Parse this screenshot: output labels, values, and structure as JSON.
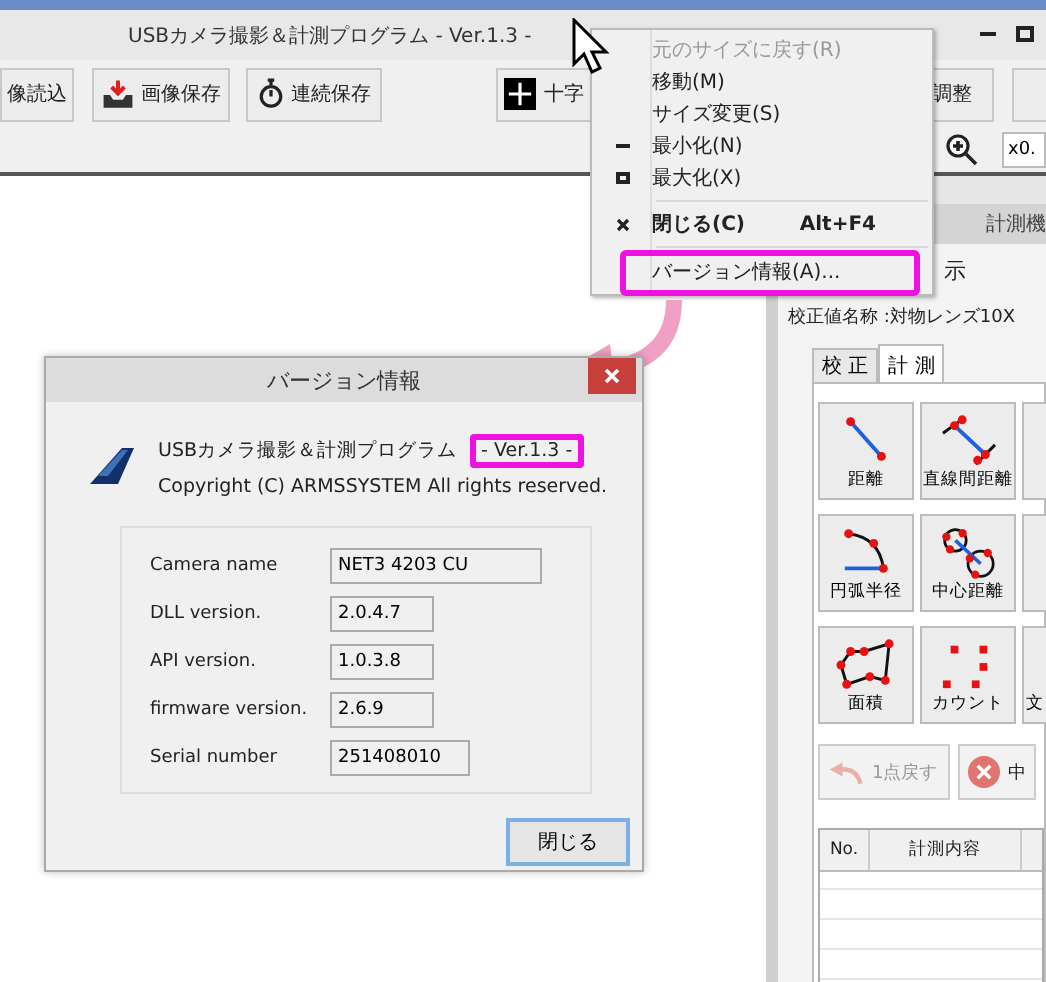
{
  "title_bar": {
    "title": "USBカメラ撮影＆計測プログラム  - Ver.1.3 -"
  },
  "toolbar": [
    {
      "label": "像読込",
      "kind": "plain"
    },
    {
      "label": "画像保存",
      "kind": "save"
    },
    {
      "label": "連続保存",
      "kind": "timer"
    },
    {
      "label": "十字",
      "kind": "cross"
    },
    {
      "label": "調整",
      "kind": "plain"
    }
  ],
  "zoom_field": {
    "value": "x0."
  },
  "system_menu": {
    "items": [
      {
        "label": "元のサイズに戻す(R)",
        "disabled": true,
        "kind": "plain",
        "separator_before": false,
        "highlighted": false
      },
      {
        "label": "移動(M)",
        "disabled": false,
        "kind": "plain",
        "separator_before": false,
        "highlighted": false
      },
      {
        "label": "サイズ変更(S)",
        "disabled": false,
        "kind": "plain",
        "separator_before": false,
        "highlighted": false
      },
      {
        "label": "最小化(N)",
        "disabled": false,
        "kind": "minimize",
        "separator_before": false,
        "highlighted": false
      },
      {
        "label": "最大化(X)",
        "disabled": false,
        "kind": "maximize",
        "separator_before": false,
        "highlighted": false
      },
      {
        "label": "閉じる(C)",
        "shortcut": "Alt+F4",
        "disabled": false,
        "kind": "close",
        "separator_before": true,
        "highlighted": false
      },
      {
        "label": "バージョン情報(A)...",
        "disabled": false,
        "kind": "plain",
        "separator_before": true,
        "highlighted": true
      }
    ]
  },
  "panel": {
    "header": "計測機",
    "display_label": "示",
    "calibration": "校正値名称 :対物レンズ10X",
    "tabs": [
      {
        "label": "校 正",
        "selected": false
      },
      {
        "label": "計 測",
        "selected": true
      }
    ],
    "tools": [
      {
        "label": "距離",
        "kind": "distance"
      },
      {
        "label": "直線間距離",
        "kind": "line_distance"
      },
      {
        "kind": "plain"
      },
      {
        "label": "円弧半径",
        "kind": "arc"
      },
      {
        "label": "中心距離",
        "kind": "center"
      },
      {
        "kind": "plain"
      },
      {
        "label": "面積",
        "kind": "area"
      },
      {
        "label": "カウント",
        "kind": "count"
      },
      {
        "label": "文",
        "kind": "plain"
      }
    ],
    "undo_button": {
      "label": "1点戻す",
      "disabled": true
    },
    "cancel_button": {
      "label": "中",
      "disabled": false
    },
    "table": {
      "columns": [
        "No.",
        "計測内容"
      ]
    }
  },
  "dialog": {
    "title": "バージョン情報",
    "app_name": "USBカメラ撮影＆計測プログラム",
    "version": "- Ver.1.3 -",
    "copyright": "Copyright (C) ARMSSYSTEM All rights reserved.",
    "fields": [
      {
        "label": "Camera name",
        "value": "NET3 4203 CU"
      },
      {
        "label": "DLL version.",
        "value": "2.0.4.7"
      },
      {
        "label": "API version.",
        "value": "1.0.3.8"
      },
      {
        "label": "firmware version.",
        "value": "2.6.9"
      },
      {
        "label": "Serial number",
        "value": "251408010"
      }
    ],
    "close_button": "閉じる"
  }
}
